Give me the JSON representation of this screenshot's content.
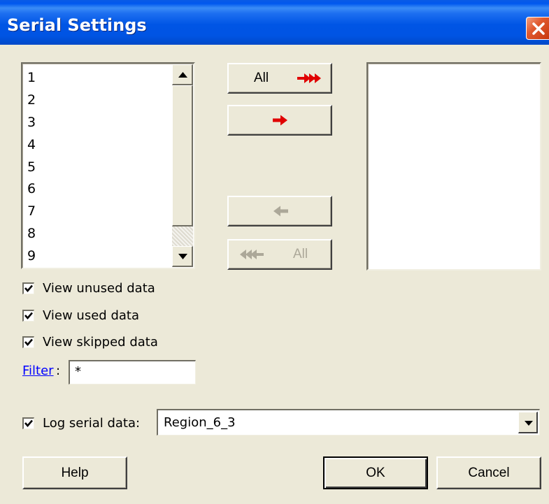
{
  "window": {
    "title": "Serial Settings",
    "close_icon": "close-icon"
  },
  "source_list": {
    "items": [
      "1",
      "2",
      "3",
      "4",
      "5",
      "6",
      "7",
      "8",
      "9"
    ]
  },
  "buttons": {
    "add_all": {
      "label": "All",
      "icon": "double-arrow-right-icon",
      "color": "#e00000",
      "enabled": true
    },
    "add_one": {
      "icon": "arrow-right-icon",
      "color": "#e00000",
      "enabled": true
    },
    "remove_one": {
      "icon": "arrow-left-icon",
      "enabled": false
    },
    "remove_all": {
      "label": "All",
      "icon": "double-arrow-left-icon",
      "enabled": false
    }
  },
  "target_list": {
    "items": []
  },
  "options": {
    "view_unused": {
      "label": "View unused data",
      "checked": true
    },
    "view_used": {
      "label": "View used data",
      "checked": true
    },
    "view_skipped": {
      "label": "View skipped data",
      "checked": true
    }
  },
  "filter": {
    "link_label": "Filter",
    "colon": ":",
    "value": "*"
  },
  "log": {
    "label": "Log serial data:",
    "checked": true,
    "value": "Region_6_3"
  },
  "footer": {
    "help_label": "Help",
    "ok_label": "OK",
    "cancel_label": "Cancel"
  }
}
